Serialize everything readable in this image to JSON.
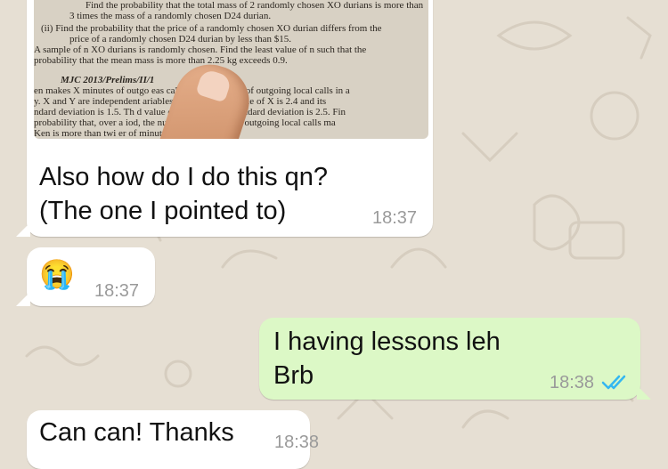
{
  "messages": [
    {
      "direction": "in",
      "type": "image",
      "caption_lines": [
        "Also how do I do this qn?",
        "(The one I pointed to)"
      ],
      "time": "18:37",
      "photo_text": [
        "Find the probability that the total mass of 2 randomly chosen XO durians is more than",
        "3 times the mass of a randomly chosen D24 durian.",
        "(ii)    Find the probability that the price of a randomly chosen XO durian differs from  the",
        "price of a randomly chosen D24 durian by less than $15.",
        "A sample of n XO durians is randomly chosen. Find the least value of n such that the",
        "probability that the mean mass is more than 2.25 kg exceeds 0.9.",
        "MJC 2013/Prelims/II/1",
        "en makes X minutes of outgo        eas calls and Y minutes of outgoing local calls in a",
        "y. X and Y are independent           ariables. The expected value of X is 2.4 and its",
        "ndard deviation is 1.5. Th          d value of Y is 5 and its standard deviation is 2.5. Fin",
        "probability that, over a           iod, the number of minutes of outgoing local calls ma",
        "Ken is more than twi              er of minutes of outgoing"
      ]
    },
    {
      "direction": "in",
      "type": "emoji",
      "emoji": "😭",
      "time": "18:37"
    },
    {
      "direction": "out",
      "type": "text",
      "lines": [
        "I having lessons leh",
        "Brb"
      ],
      "time": "18:38",
      "status": "read"
    },
    {
      "direction": "in",
      "type": "text",
      "lines": [
        "Can can! Thanks"
      ],
      "time": "18:38"
    }
  ],
  "colors": {
    "incoming_bubble": "#ffffff",
    "outgoing_bubble": "#dcf8c6",
    "read_check": "#34b7f1",
    "background": "#e6dfd3"
  },
  "icons": {
    "read_receipt": "double-check-icon"
  }
}
